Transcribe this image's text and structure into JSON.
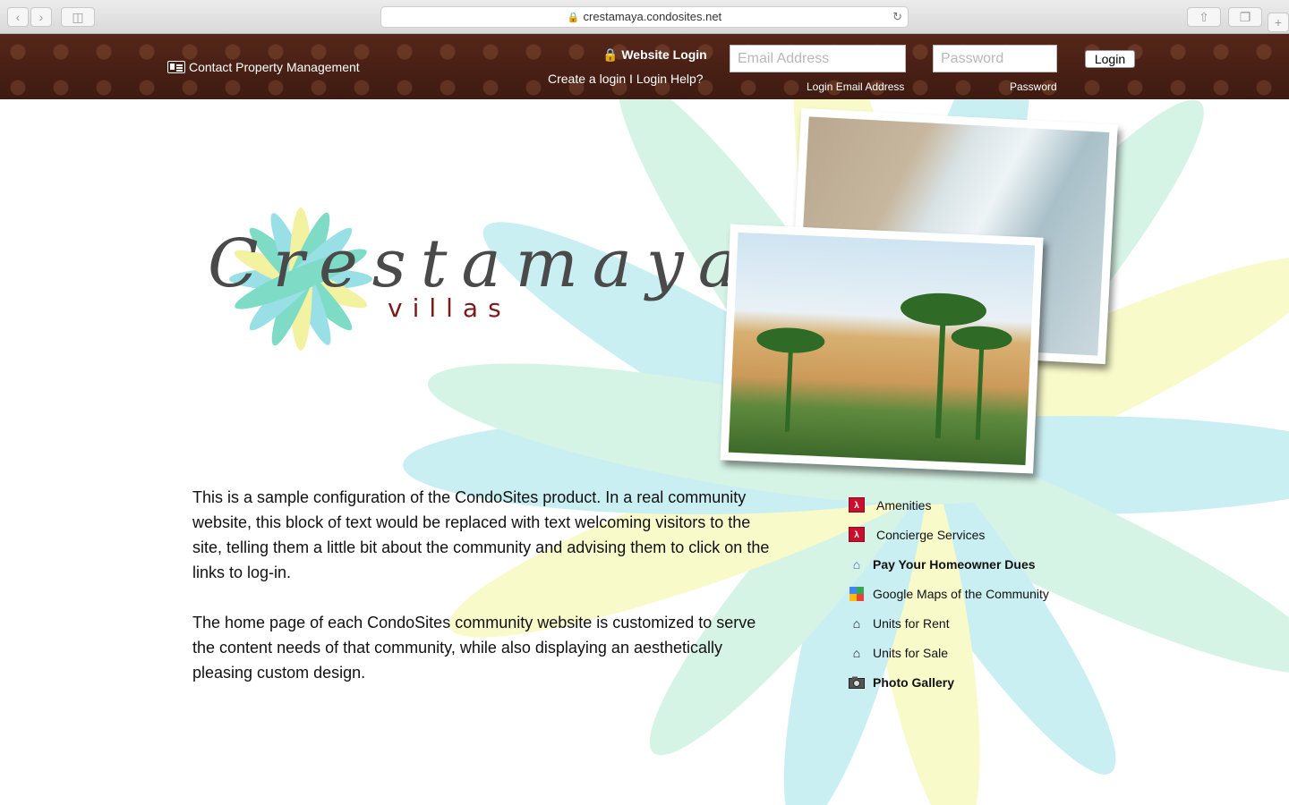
{
  "browser": {
    "url": "crestamaya.condosites.net"
  },
  "header": {
    "contact_label": "Contact Property Management",
    "login_title": "Website Login",
    "login_links": "Create a login I Login Help?",
    "email_placeholder": "Email Address",
    "password_placeholder": "Password",
    "email_label": "Login Email Address",
    "password_label": "Password",
    "login_button": "Login"
  },
  "logo": {
    "word": "Crestamaya",
    "sub": "villas"
  },
  "intro": {
    "paragraph1": "This is a sample configuration of the CondoSites product. In a real community website, this block of text would be replaced with text welcoming visitors to the site, telling them a little bit about the community and advising them to click on the links to log-in.",
    "paragraph2": "The home page of each CondoSites community website is customized to serve the content needs of that community, while also displaying an aesthetically pleasing custom design."
  },
  "links": [
    {
      "label": "Amenities",
      "icon": "pdf-icon",
      "bold": false
    },
    {
      "label": "Concierge Services",
      "icon": "pdf-icon",
      "bold": false
    },
    {
      "label": "Pay Your Homeowner Dues",
      "icon": "dues-icon",
      "bold": true
    },
    {
      "label": "Google Maps of the Community",
      "icon": "map-icon",
      "bold": false
    },
    {
      "label": "Units for Rent",
      "icon": "house-icon",
      "bold": false
    },
    {
      "label": "Units for Sale",
      "icon": "house-icon",
      "bold": false
    },
    {
      "label": "Photo Gallery",
      "icon": "camera-icon",
      "bold": true
    }
  ],
  "colors": {
    "header_bg": "#4a2015",
    "logo_text": "#4a4a4a",
    "logo_sub": "#7a1a1a",
    "petal_teal": "#8fe0e6",
    "petal_green": "#a8e6c8",
    "petal_yellow": "#f4f59a"
  }
}
